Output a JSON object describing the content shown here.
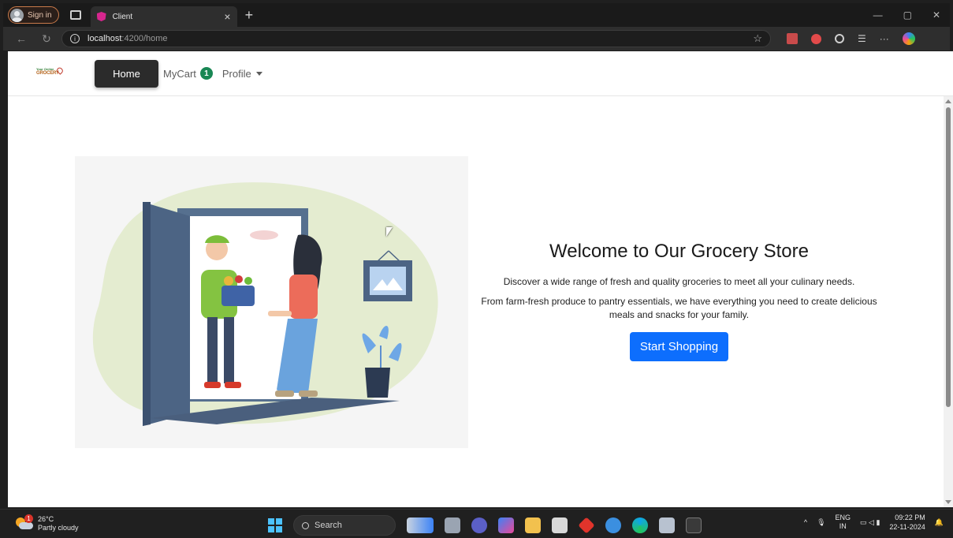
{
  "browser": {
    "signin_label": "Sign in",
    "tab_title": "Client",
    "tab_close": "×",
    "new_tab": "+",
    "url_host": "localhost",
    "url_path": ":4200/home",
    "window_controls": {
      "minimize": "—",
      "restore": "▢",
      "close": "✕"
    }
  },
  "app": {
    "logo_top": "Your Online",
    "logo_main": "GROCERY",
    "nav": {
      "home_label": "Home",
      "cart_label": "MyCart",
      "cart_count": "1",
      "profile_label": "Profile"
    },
    "hero": {
      "title": "Welcome to Our Grocery Store",
      "line1": "Discover a wide range of fresh and quality groceries to meet all your culinary needs.",
      "line2": "From farm-fresh produce to pantry essentials, we have everything you need to create delicious meals and snacks for your family.",
      "cta_label": "Start Shopping"
    },
    "colors": {
      "primary": "#0d6efd",
      "badge": "#198754",
      "home_btn": "#2b2b2b"
    }
  },
  "taskbar": {
    "weather_alert": "1",
    "weather_temp": "26°C",
    "weather_desc": "Partly cloudy",
    "search_label": "Search",
    "lang_top": "ENG",
    "lang_bottom": "IN",
    "time": "09:22 PM",
    "date": "22-11-2024"
  }
}
